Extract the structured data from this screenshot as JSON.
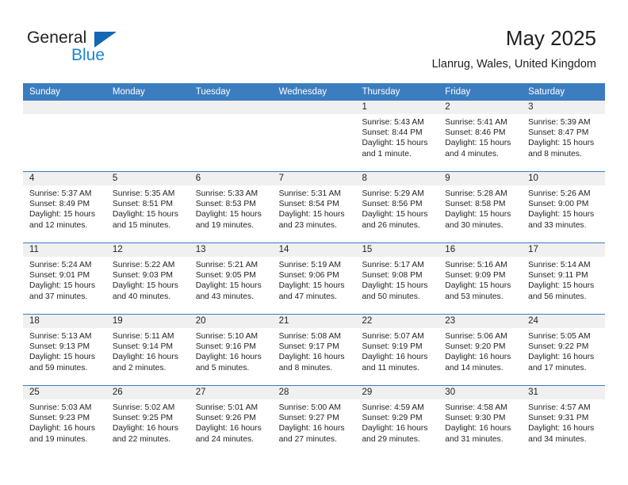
{
  "brand": {
    "word_one": "General",
    "word_two": "Blue",
    "flag_icon": "triangle-flag-icon",
    "accent_color": "#1268b3",
    "secondary_color": "#1b86d0"
  },
  "header": {
    "month_title": "May 2025",
    "location": "Llanrug, Wales, United Kingdom"
  },
  "theme": {
    "header_row_bg": "#3b7dbf",
    "day_band_bg": "#f0f0f0",
    "cell_bg": "#ffffff",
    "text_color": "#231f20"
  },
  "weekdays": [
    "Sunday",
    "Monday",
    "Tuesday",
    "Wednesday",
    "Thursday",
    "Friday",
    "Saturday"
  ],
  "weeks": [
    [
      {
        "day": "",
        "empty": true,
        "sunrise": "",
        "sunset": "",
        "daylight_line1": "",
        "daylight_line2": ""
      },
      {
        "day": "",
        "empty": true,
        "sunrise": "",
        "sunset": "",
        "daylight_line1": "",
        "daylight_line2": ""
      },
      {
        "day": "",
        "empty": true,
        "sunrise": "",
        "sunset": "",
        "daylight_line1": "",
        "daylight_line2": ""
      },
      {
        "day": "",
        "empty": true,
        "sunrise": "",
        "sunset": "",
        "daylight_line1": "",
        "daylight_line2": ""
      },
      {
        "day": "1",
        "empty": false,
        "sunrise": "Sunrise: 5:43 AM",
        "sunset": "Sunset: 8:44 PM",
        "daylight_line1": "Daylight: 15 hours",
        "daylight_line2": "and 1 minute."
      },
      {
        "day": "2",
        "empty": false,
        "sunrise": "Sunrise: 5:41 AM",
        "sunset": "Sunset: 8:46 PM",
        "daylight_line1": "Daylight: 15 hours",
        "daylight_line2": "and 4 minutes."
      },
      {
        "day": "3",
        "empty": false,
        "sunrise": "Sunrise: 5:39 AM",
        "sunset": "Sunset: 8:47 PM",
        "daylight_line1": "Daylight: 15 hours",
        "daylight_line2": "and 8 minutes."
      }
    ],
    [
      {
        "day": "4",
        "empty": false,
        "sunrise": "Sunrise: 5:37 AM",
        "sunset": "Sunset: 8:49 PM",
        "daylight_line1": "Daylight: 15 hours",
        "daylight_line2": "and 12 minutes."
      },
      {
        "day": "5",
        "empty": false,
        "sunrise": "Sunrise: 5:35 AM",
        "sunset": "Sunset: 8:51 PM",
        "daylight_line1": "Daylight: 15 hours",
        "daylight_line2": "and 15 minutes."
      },
      {
        "day": "6",
        "empty": false,
        "sunrise": "Sunrise: 5:33 AM",
        "sunset": "Sunset: 8:53 PM",
        "daylight_line1": "Daylight: 15 hours",
        "daylight_line2": "and 19 minutes."
      },
      {
        "day": "7",
        "empty": false,
        "sunrise": "Sunrise: 5:31 AM",
        "sunset": "Sunset: 8:54 PM",
        "daylight_line1": "Daylight: 15 hours",
        "daylight_line2": "and 23 minutes."
      },
      {
        "day": "8",
        "empty": false,
        "sunrise": "Sunrise: 5:29 AM",
        "sunset": "Sunset: 8:56 PM",
        "daylight_line1": "Daylight: 15 hours",
        "daylight_line2": "and 26 minutes."
      },
      {
        "day": "9",
        "empty": false,
        "sunrise": "Sunrise: 5:28 AM",
        "sunset": "Sunset: 8:58 PM",
        "daylight_line1": "Daylight: 15 hours",
        "daylight_line2": "and 30 minutes."
      },
      {
        "day": "10",
        "empty": false,
        "sunrise": "Sunrise: 5:26 AM",
        "sunset": "Sunset: 9:00 PM",
        "daylight_line1": "Daylight: 15 hours",
        "daylight_line2": "and 33 minutes."
      }
    ],
    [
      {
        "day": "11",
        "empty": false,
        "sunrise": "Sunrise: 5:24 AM",
        "sunset": "Sunset: 9:01 PM",
        "daylight_line1": "Daylight: 15 hours",
        "daylight_line2": "and 37 minutes."
      },
      {
        "day": "12",
        "empty": false,
        "sunrise": "Sunrise: 5:22 AM",
        "sunset": "Sunset: 9:03 PM",
        "daylight_line1": "Daylight: 15 hours",
        "daylight_line2": "and 40 minutes."
      },
      {
        "day": "13",
        "empty": false,
        "sunrise": "Sunrise: 5:21 AM",
        "sunset": "Sunset: 9:05 PM",
        "daylight_line1": "Daylight: 15 hours",
        "daylight_line2": "and 43 minutes."
      },
      {
        "day": "14",
        "empty": false,
        "sunrise": "Sunrise: 5:19 AM",
        "sunset": "Sunset: 9:06 PM",
        "daylight_line1": "Daylight: 15 hours",
        "daylight_line2": "and 47 minutes."
      },
      {
        "day": "15",
        "empty": false,
        "sunrise": "Sunrise: 5:17 AM",
        "sunset": "Sunset: 9:08 PM",
        "daylight_line1": "Daylight: 15 hours",
        "daylight_line2": "and 50 minutes."
      },
      {
        "day": "16",
        "empty": false,
        "sunrise": "Sunrise: 5:16 AM",
        "sunset": "Sunset: 9:09 PM",
        "daylight_line1": "Daylight: 15 hours",
        "daylight_line2": "and 53 minutes."
      },
      {
        "day": "17",
        "empty": false,
        "sunrise": "Sunrise: 5:14 AM",
        "sunset": "Sunset: 9:11 PM",
        "daylight_line1": "Daylight: 15 hours",
        "daylight_line2": "and 56 minutes."
      }
    ],
    [
      {
        "day": "18",
        "empty": false,
        "sunrise": "Sunrise: 5:13 AM",
        "sunset": "Sunset: 9:13 PM",
        "daylight_line1": "Daylight: 15 hours",
        "daylight_line2": "and 59 minutes."
      },
      {
        "day": "19",
        "empty": false,
        "sunrise": "Sunrise: 5:11 AM",
        "sunset": "Sunset: 9:14 PM",
        "daylight_line1": "Daylight: 16 hours",
        "daylight_line2": "and 2 minutes."
      },
      {
        "day": "20",
        "empty": false,
        "sunrise": "Sunrise: 5:10 AM",
        "sunset": "Sunset: 9:16 PM",
        "daylight_line1": "Daylight: 16 hours",
        "daylight_line2": "and 5 minutes."
      },
      {
        "day": "21",
        "empty": false,
        "sunrise": "Sunrise: 5:08 AM",
        "sunset": "Sunset: 9:17 PM",
        "daylight_line1": "Daylight: 16 hours",
        "daylight_line2": "and 8 minutes."
      },
      {
        "day": "22",
        "empty": false,
        "sunrise": "Sunrise: 5:07 AM",
        "sunset": "Sunset: 9:19 PM",
        "daylight_line1": "Daylight: 16 hours",
        "daylight_line2": "and 11 minutes."
      },
      {
        "day": "23",
        "empty": false,
        "sunrise": "Sunrise: 5:06 AM",
        "sunset": "Sunset: 9:20 PM",
        "daylight_line1": "Daylight: 16 hours",
        "daylight_line2": "and 14 minutes."
      },
      {
        "day": "24",
        "empty": false,
        "sunrise": "Sunrise: 5:05 AM",
        "sunset": "Sunset: 9:22 PM",
        "daylight_line1": "Daylight: 16 hours",
        "daylight_line2": "and 17 minutes."
      }
    ],
    [
      {
        "day": "25",
        "empty": false,
        "sunrise": "Sunrise: 5:03 AM",
        "sunset": "Sunset: 9:23 PM",
        "daylight_line1": "Daylight: 16 hours",
        "daylight_line2": "and 19 minutes."
      },
      {
        "day": "26",
        "empty": false,
        "sunrise": "Sunrise: 5:02 AM",
        "sunset": "Sunset: 9:25 PM",
        "daylight_line1": "Daylight: 16 hours",
        "daylight_line2": "and 22 minutes."
      },
      {
        "day": "27",
        "empty": false,
        "sunrise": "Sunrise: 5:01 AM",
        "sunset": "Sunset: 9:26 PM",
        "daylight_line1": "Daylight: 16 hours",
        "daylight_line2": "and 24 minutes."
      },
      {
        "day": "28",
        "empty": false,
        "sunrise": "Sunrise: 5:00 AM",
        "sunset": "Sunset: 9:27 PM",
        "daylight_line1": "Daylight: 16 hours",
        "daylight_line2": "and 27 minutes."
      },
      {
        "day": "29",
        "empty": false,
        "sunrise": "Sunrise: 4:59 AM",
        "sunset": "Sunset: 9:29 PM",
        "daylight_line1": "Daylight: 16 hours",
        "daylight_line2": "and 29 minutes."
      },
      {
        "day": "30",
        "empty": false,
        "sunrise": "Sunrise: 4:58 AM",
        "sunset": "Sunset: 9:30 PM",
        "daylight_line1": "Daylight: 16 hours",
        "daylight_line2": "and 31 minutes."
      },
      {
        "day": "31",
        "empty": false,
        "sunrise": "Sunrise: 4:57 AM",
        "sunset": "Sunset: 9:31 PM",
        "daylight_line1": "Daylight: 16 hours",
        "daylight_line2": "and 34 minutes."
      }
    ]
  ]
}
